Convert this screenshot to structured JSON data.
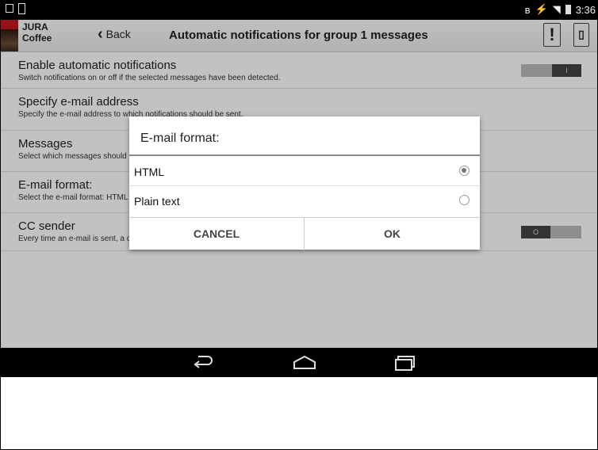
{
  "status_bar": {
    "time": "3:36"
  },
  "header": {
    "brand_line1": "JURA",
    "brand_line2": "Coffee",
    "back_label": "Back",
    "title": "Automatic notifications for group 1 messages",
    "alert_icon_glyph": "!"
  },
  "settings": [
    {
      "title": "Enable automatic notifications",
      "subtitle": "Switch notifications on or off if the selected messages have been detected."
    },
    {
      "title": "Specify e-mail address",
      "subtitle": "Specify the e-mail address to which notifications should be sent."
    },
    {
      "title": "Messages",
      "subtitle": "Select which messages should trigger a notification."
    },
    {
      "title": "E-mail format:",
      "subtitle": "Select the e-mail format: HTML"
    },
    {
      "title": "CC sender",
      "subtitle": "Every time an e-mail is sent, a copy is also sent to the sender."
    }
  ],
  "toggles": {
    "notifications_label": "I",
    "cc_label": "O"
  },
  "dialog": {
    "title": "E-mail format:",
    "options": [
      {
        "label": "HTML",
        "selected": true
      },
      {
        "label": "Plain text",
        "selected": false
      }
    ],
    "cancel_label": "CANCEL",
    "ok_label": "OK"
  },
  "colors": {
    "dialog_divider": "#888888",
    "status_bar": "#000000",
    "brand_red": "#c7181f"
  }
}
